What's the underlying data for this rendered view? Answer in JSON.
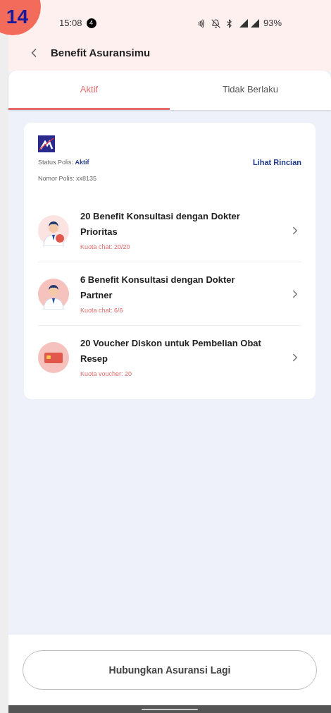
{
  "annotation": {
    "label": "14"
  },
  "status_bar": {
    "time": "15:08",
    "notification_count": "4",
    "battery": "93%"
  },
  "header": {
    "title": "Benefit Asuransimu"
  },
  "tabs": [
    {
      "label": "Aktif",
      "selected": true
    },
    {
      "label": "Tidak Berlaku",
      "selected": false
    }
  ],
  "policy": {
    "status_label": "Status Polis:",
    "status_value": "Aktif",
    "number_label": "Nomor Polis:",
    "number_value": "xx8135",
    "details_link": "Lihat Rincian",
    "benefits": [
      {
        "kind": "doctor-badge",
        "title": "20 Benefit Konsultasi dengan Dokter Prioritas",
        "quota": "Kuota chat: 20/20"
      },
      {
        "kind": "doctor",
        "title": "6 Benefit Konsultasi dengan Dokter Partner",
        "quota": "Kuota chat: 6/6"
      },
      {
        "kind": "card",
        "title": "20 Voucher Diskon untuk Pembelian Obat Resep",
        "quota": "Kuota voucher: 20"
      }
    ]
  },
  "footer": {
    "button": "Hubungkan Asuransi Lagi"
  }
}
